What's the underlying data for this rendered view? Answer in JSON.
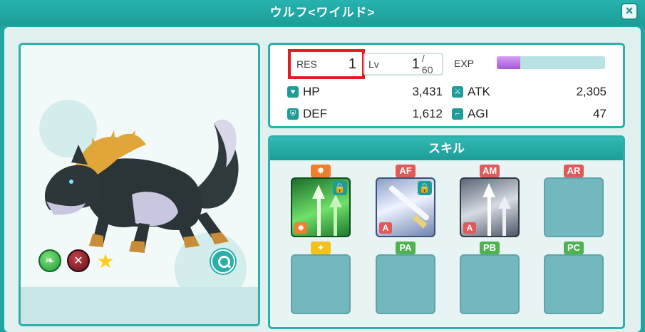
{
  "window": {
    "title": "ウルフ<ワイルド>",
    "close_label": "×"
  },
  "portrait": {
    "magnify_label": ""
  },
  "stats": {
    "res_label": "RES",
    "res_value": "1",
    "lv_label": "Lv",
    "lv_current": "1",
    "lv_max": "/ 60",
    "exp_label": "EXP",
    "exp_fraction": 0.22,
    "hp_label": "HP",
    "hp_value": "3,431",
    "atk_label": "ATK",
    "atk_value": "2,305",
    "def_label": "DEF",
    "def_value": "1,612",
    "agi_label": "AGI",
    "agi_value": "47"
  },
  "skills": {
    "header": "スキル",
    "slots": [
      {
        "tag": "",
        "tag_icon": "sparkle-icon",
        "mini": "",
        "locked": true
      },
      {
        "tag": "AF",
        "mini": "A",
        "locked": true
      },
      {
        "tag": "AM",
        "mini": "A",
        "locked": false
      },
      {
        "tag": "AR",
        "mini": "",
        "locked": false
      },
      {
        "tag": "",
        "tag_icon": "star-sparkle-icon"
      },
      {
        "tag": "PA"
      },
      {
        "tag": "PB"
      },
      {
        "tag": "PC"
      }
    ]
  },
  "colors": {
    "accent": "#1d9c98",
    "highlight": "#e31b23",
    "exp": "#a659d8"
  }
}
